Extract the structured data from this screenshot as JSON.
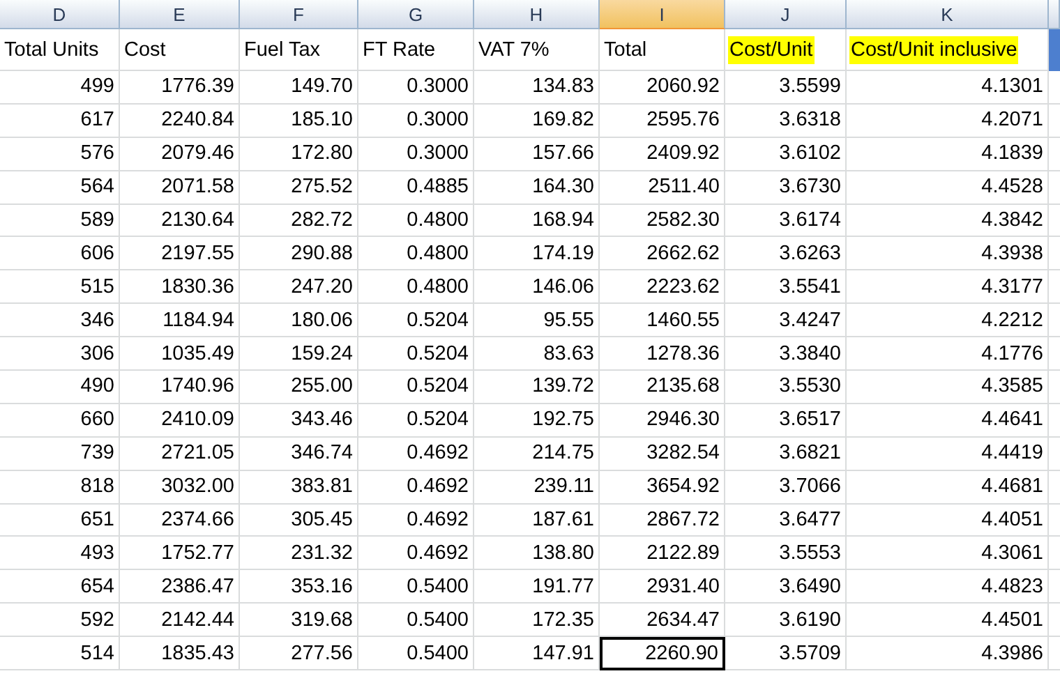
{
  "column_letters": [
    {
      "label": "D",
      "selected": false
    },
    {
      "label": "E",
      "selected": false
    },
    {
      "label": "F",
      "selected": false
    },
    {
      "label": "G",
      "selected": false
    },
    {
      "label": "H",
      "selected": false
    },
    {
      "label": "I",
      "selected": true
    },
    {
      "label": "J",
      "selected": false
    },
    {
      "label": "K",
      "selected": false
    }
  ],
  "headers": [
    {
      "text": "Total Units",
      "highlighted": false
    },
    {
      "text": "Cost",
      "highlighted": false
    },
    {
      "text": "Fuel Tax",
      "highlighted": false
    },
    {
      "text": "FT Rate",
      "highlighted": false
    },
    {
      "text": "VAT 7%",
      "highlighted": false
    },
    {
      "text": "Total",
      "highlighted": false
    },
    {
      "text": "Cost/Unit",
      "highlighted": true
    },
    {
      "text": "Cost/Unit inclusive",
      "highlighted": true
    }
  ],
  "rows": [
    {
      "cells": [
        "499",
        "1776.39",
        "149.70",
        "0.3000",
        "134.83",
        "2060.92",
        "3.5599",
        "4.1301"
      ]
    },
    {
      "cells": [
        "617",
        "2240.84",
        "185.10",
        "0.3000",
        "169.82",
        "2595.76",
        "3.6318",
        "4.2071"
      ]
    },
    {
      "cells": [
        "576",
        "2079.46",
        "172.80",
        "0.3000",
        "157.66",
        "2409.92",
        "3.6102",
        "4.1839"
      ]
    },
    {
      "cells": [
        "564",
        "2071.58",
        "275.52",
        "0.4885",
        "164.30",
        "2511.40",
        "3.6730",
        "4.4528"
      ]
    },
    {
      "cells": [
        "589",
        "2130.64",
        "282.72",
        "0.4800",
        "168.94",
        "2582.30",
        "3.6174",
        "4.3842"
      ]
    },
    {
      "cells": [
        "606",
        "2197.55",
        "290.88",
        "0.4800",
        "174.19",
        "2662.62",
        "3.6263",
        "4.3938"
      ]
    },
    {
      "cells": [
        "515",
        "1830.36",
        "247.20",
        "0.4800",
        "146.06",
        "2223.62",
        "3.5541",
        "4.3177"
      ]
    },
    {
      "cells": [
        "346",
        "1184.94",
        "180.06",
        "0.5204",
        "95.55",
        "1460.55",
        "3.4247",
        "4.2212"
      ]
    },
    {
      "cells": [
        "306",
        "1035.49",
        "159.24",
        "0.5204",
        "83.63",
        "1278.36",
        "3.3840",
        "4.1776"
      ]
    },
    {
      "cells": [
        "490",
        "1740.96",
        "255.00",
        "0.5204",
        "139.72",
        "2135.68",
        "3.5530",
        "4.3585"
      ]
    },
    {
      "cells": [
        "660",
        "2410.09",
        "343.46",
        "0.5204",
        "192.75",
        "2946.30",
        "3.6517",
        "4.4641"
      ]
    },
    {
      "cells": [
        "739",
        "2721.05",
        "346.74",
        "0.4692",
        "214.75",
        "3282.54",
        "3.6821",
        "4.4419"
      ]
    },
    {
      "cells": [
        "818",
        "3032.00",
        "383.81",
        "0.4692",
        "239.11",
        "3654.92",
        "3.7066",
        "4.4681"
      ]
    },
    {
      "cells": [
        "651",
        "2374.66",
        "305.45",
        "0.4692",
        "187.61",
        "2867.72",
        "3.6477",
        "4.4051"
      ]
    },
    {
      "cells": [
        "493",
        "1752.77",
        "231.32",
        "0.4692",
        "138.80",
        "2122.89",
        "3.5553",
        "4.3061"
      ]
    },
    {
      "cells": [
        "654",
        "2386.47",
        "353.16",
        "0.5400",
        "191.77",
        "2931.40",
        "3.6490",
        "4.4823"
      ]
    },
    {
      "cells": [
        "592",
        "2142.44",
        "319.68",
        "0.5400",
        "172.35",
        "2634.47",
        "3.6190",
        "4.4501"
      ]
    },
    {
      "cells": [
        {
          "text": "514",
          "selected": false
        },
        {
          "text": "1835.43",
          "selected": false
        },
        {
          "text": "277.56",
          "selected": false
        },
        {
          "text": "0.5400",
          "selected": false
        },
        {
          "text": "147.91",
          "selected": false
        },
        {
          "text": "2260.90",
          "selected": true
        },
        {
          "text": "3.5709",
          "selected": false
        },
        {
          "text": "4.3986",
          "selected": false
        }
      ]
    }
  ]
}
